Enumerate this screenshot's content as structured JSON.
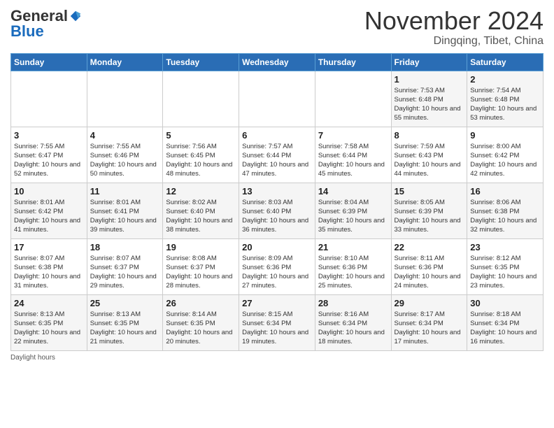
{
  "logo": {
    "general": "General",
    "blue": "Blue"
  },
  "header": {
    "month": "November 2024",
    "location": "Dingqing, Tibet, China"
  },
  "days_of_week": [
    "Sunday",
    "Monday",
    "Tuesday",
    "Wednesday",
    "Thursday",
    "Friday",
    "Saturday"
  ],
  "weeks": [
    [
      {
        "day": "",
        "info": ""
      },
      {
        "day": "",
        "info": ""
      },
      {
        "day": "",
        "info": ""
      },
      {
        "day": "",
        "info": ""
      },
      {
        "day": "",
        "info": ""
      },
      {
        "day": "1",
        "info": "Sunrise: 7:53 AM\nSunset: 6:48 PM\nDaylight: 10 hours and 55 minutes."
      },
      {
        "day": "2",
        "info": "Sunrise: 7:54 AM\nSunset: 6:48 PM\nDaylight: 10 hours and 53 minutes."
      }
    ],
    [
      {
        "day": "3",
        "info": "Sunrise: 7:55 AM\nSunset: 6:47 PM\nDaylight: 10 hours and 52 minutes."
      },
      {
        "day": "4",
        "info": "Sunrise: 7:55 AM\nSunset: 6:46 PM\nDaylight: 10 hours and 50 minutes."
      },
      {
        "day": "5",
        "info": "Sunrise: 7:56 AM\nSunset: 6:45 PM\nDaylight: 10 hours and 48 minutes."
      },
      {
        "day": "6",
        "info": "Sunrise: 7:57 AM\nSunset: 6:44 PM\nDaylight: 10 hours and 47 minutes."
      },
      {
        "day": "7",
        "info": "Sunrise: 7:58 AM\nSunset: 6:44 PM\nDaylight: 10 hours and 45 minutes."
      },
      {
        "day": "8",
        "info": "Sunrise: 7:59 AM\nSunset: 6:43 PM\nDaylight: 10 hours and 44 minutes."
      },
      {
        "day": "9",
        "info": "Sunrise: 8:00 AM\nSunset: 6:42 PM\nDaylight: 10 hours and 42 minutes."
      }
    ],
    [
      {
        "day": "10",
        "info": "Sunrise: 8:01 AM\nSunset: 6:42 PM\nDaylight: 10 hours and 41 minutes."
      },
      {
        "day": "11",
        "info": "Sunrise: 8:01 AM\nSunset: 6:41 PM\nDaylight: 10 hours and 39 minutes."
      },
      {
        "day": "12",
        "info": "Sunrise: 8:02 AM\nSunset: 6:40 PM\nDaylight: 10 hours and 38 minutes."
      },
      {
        "day": "13",
        "info": "Sunrise: 8:03 AM\nSunset: 6:40 PM\nDaylight: 10 hours and 36 minutes."
      },
      {
        "day": "14",
        "info": "Sunrise: 8:04 AM\nSunset: 6:39 PM\nDaylight: 10 hours and 35 minutes."
      },
      {
        "day": "15",
        "info": "Sunrise: 8:05 AM\nSunset: 6:39 PM\nDaylight: 10 hours and 33 minutes."
      },
      {
        "day": "16",
        "info": "Sunrise: 8:06 AM\nSunset: 6:38 PM\nDaylight: 10 hours and 32 minutes."
      }
    ],
    [
      {
        "day": "17",
        "info": "Sunrise: 8:07 AM\nSunset: 6:38 PM\nDaylight: 10 hours and 31 minutes."
      },
      {
        "day": "18",
        "info": "Sunrise: 8:07 AM\nSunset: 6:37 PM\nDaylight: 10 hours and 29 minutes."
      },
      {
        "day": "19",
        "info": "Sunrise: 8:08 AM\nSunset: 6:37 PM\nDaylight: 10 hours and 28 minutes."
      },
      {
        "day": "20",
        "info": "Sunrise: 8:09 AM\nSunset: 6:36 PM\nDaylight: 10 hours and 27 minutes."
      },
      {
        "day": "21",
        "info": "Sunrise: 8:10 AM\nSunset: 6:36 PM\nDaylight: 10 hours and 25 minutes."
      },
      {
        "day": "22",
        "info": "Sunrise: 8:11 AM\nSunset: 6:36 PM\nDaylight: 10 hours and 24 minutes."
      },
      {
        "day": "23",
        "info": "Sunrise: 8:12 AM\nSunset: 6:35 PM\nDaylight: 10 hours and 23 minutes."
      }
    ],
    [
      {
        "day": "24",
        "info": "Sunrise: 8:13 AM\nSunset: 6:35 PM\nDaylight: 10 hours and 22 minutes."
      },
      {
        "day": "25",
        "info": "Sunrise: 8:13 AM\nSunset: 6:35 PM\nDaylight: 10 hours and 21 minutes."
      },
      {
        "day": "26",
        "info": "Sunrise: 8:14 AM\nSunset: 6:35 PM\nDaylight: 10 hours and 20 minutes."
      },
      {
        "day": "27",
        "info": "Sunrise: 8:15 AM\nSunset: 6:34 PM\nDaylight: 10 hours and 19 minutes."
      },
      {
        "day": "28",
        "info": "Sunrise: 8:16 AM\nSunset: 6:34 PM\nDaylight: 10 hours and 18 minutes."
      },
      {
        "day": "29",
        "info": "Sunrise: 8:17 AM\nSunset: 6:34 PM\nDaylight: 10 hours and 17 minutes."
      },
      {
        "day": "30",
        "info": "Sunrise: 8:18 AM\nSunset: 6:34 PM\nDaylight: 10 hours and 16 minutes."
      }
    ]
  ],
  "footer": {
    "daylight_label": "Daylight hours"
  }
}
